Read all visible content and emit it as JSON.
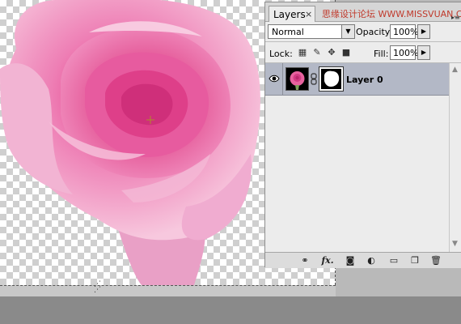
{
  "panel": {
    "tab_label": "Layers",
    "tab_close": "×",
    "watermark": "思缘设计论坛 WWW.MISSVUAN.COM",
    "menu_icon": "panel-menu-icon",
    "blend_mode": "Normal",
    "opacity_label": "Opacity:",
    "opacity_value": "100%",
    "lock_label": "Lock:",
    "fill_label": "Fill:",
    "fill_value": "100%"
  },
  "layers": [
    {
      "name": "Layer 0",
      "visible": true,
      "selected": true,
      "has_mask": true,
      "linked": true
    }
  ],
  "lock_buttons": [
    "lock-transparent-pixels-icon",
    "lock-image-pixels-icon",
    "lock-position-icon",
    "lock-all-icon"
  ],
  "toolbar": {
    "link_icon": "link-layers-icon",
    "fx_label": "fx.",
    "buttons": [
      "add-layer-mask-icon",
      "adjustment-layer-icon",
      "new-group-icon",
      "new-layer-icon",
      "delete-layer-icon"
    ]
  },
  "colors": {
    "selected_row": "#b3b8c6",
    "panel_bg": "#ececec",
    "rose_pink": "#e7589e"
  }
}
